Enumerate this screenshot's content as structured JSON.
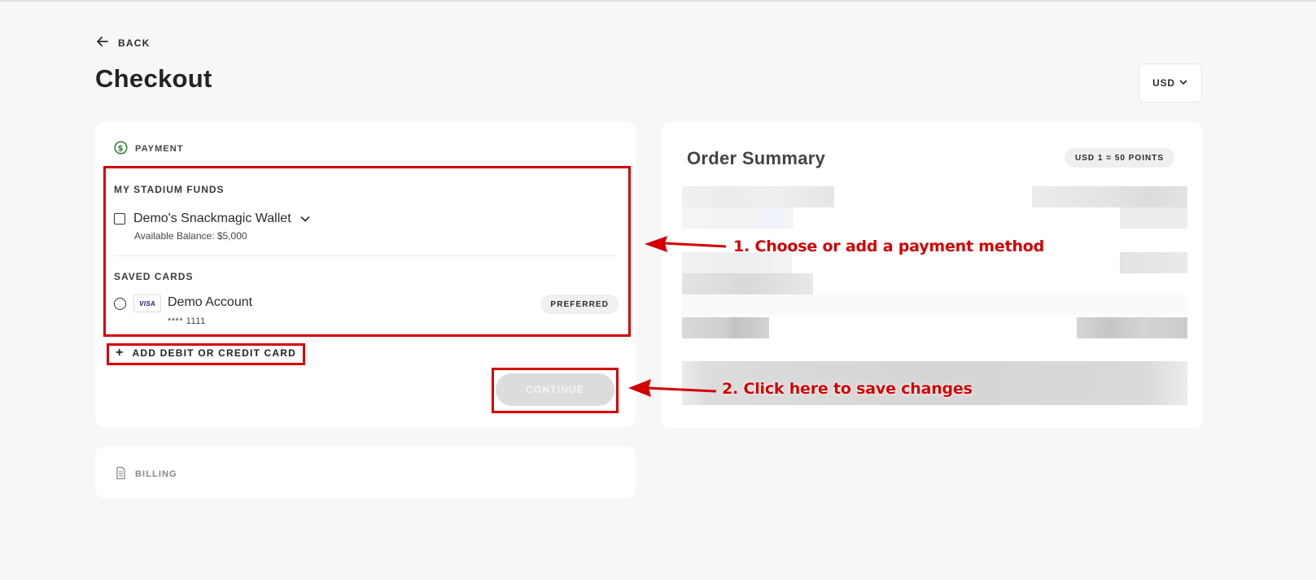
{
  "nav": {
    "back_label": "BACK"
  },
  "page": {
    "title": "Checkout"
  },
  "currency": {
    "selected": "USD"
  },
  "payment": {
    "section_label": "PAYMENT",
    "stadium_funds_label": "MY STADIUM FUNDS",
    "wallet": {
      "name": "Demo's Snackmagic Wallet",
      "balance": "Available Balance: $5,000"
    },
    "saved_cards_label": "SAVED CARDS",
    "saved_card": {
      "brand": "VISA",
      "name": "Demo Account",
      "number": "**** 1111",
      "badge": "PREFERRED"
    },
    "add_card_label": "ADD DEBIT OR CREDIT CARD",
    "continue_label": "CONTINUE"
  },
  "billing": {
    "section_label": "BILLING"
  },
  "summary": {
    "title": "Order Summary",
    "rate_badge": "USD 1 = 50 POINTS"
  },
  "annotations": {
    "step1": "1. Choose or add a payment method",
    "step2": "2. Click here to save changes"
  },
  "colors": {
    "highlight": "#d40000",
    "page_bg": "#f7f7f7",
    "disabled_button": "#dcdcdc"
  },
  "icons": {
    "back": "arrow-left-icon",
    "currency": "chevron-down-icon",
    "payment": "dollar-circle-icon",
    "wallet": "chevron-down-icon",
    "billing": "document-icon",
    "add": "plus-icon"
  }
}
